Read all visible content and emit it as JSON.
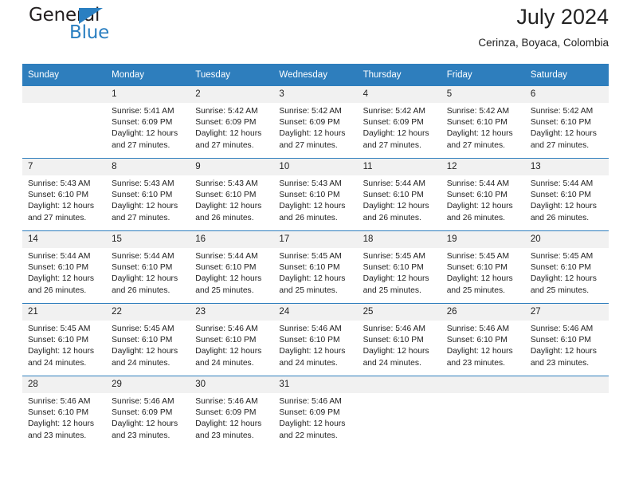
{
  "brand": {
    "name_top": "General",
    "name_bottom": "Blue",
    "accent_color": "#2a7fc1"
  },
  "header": {
    "month_title": "July 2024",
    "location": "Cerinza, Boyaca, Colombia"
  },
  "calendar": {
    "header_bg": "#2e7ebd",
    "daynum_bg": "#f1f1f1",
    "weekday_names": [
      "Sunday",
      "Monday",
      "Tuesday",
      "Wednesday",
      "Thursday",
      "Friday",
      "Saturday"
    ],
    "weeks": [
      [
        {
          "day": "",
          "sunrise": "",
          "sunset": "",
          "daylight_1": "",
          "daylight_2": ""
        },
        {
          "day": "1",
          "sunrise": "Sunrise: 5:41 AM",
          "sunset": "Sunset: 6:09 PM",
          "daylight_1": "Daylight: 12 hours",
          "daylight_2": "and 27 minutes."
        },
        {
          "day": "2",
          "sunrise": "Sunrise: 5:42 AM",
          "sunset": "Sunset: 6:09 PM",
          "daylight_1": "Daylight: 12 hours",
          "daylight_2": "and 27 minutes."
        },
        {
          "day": "3",
          "sunrise": "Sunrise: 5:42 AM",
          "sunset": "Sunset: 6:09 PM",
          "daylight_1": "Daylight: 12 hours",
          "daylight_2": "and 27 minutes."
        },
        {
          "day": "4",
          "sunrise": "Sunrise: 5:42 AM",
          "sunset": "Sunset: 6:09 PM",
          "daylight_1": "Daylight: 12 hours",
          "daylight_2": "and 27 minutes."
        },
        {
          "day": "5",
          "sunrise": "Sunrise: 5:42 AM",
          "sunset": "Sunset: 6:10 PM",
          "daylight_1": "Daylight: 12 hours",
          "daylight_2": "and 27 minutes."
        },
        {
          "day": "6",
          "sunrise": "Sunrise: 5:42 AM",
          "sunset": "Sunset: 6:10 PM",
          "daylight_1": "Daylight: 12 hours",
          "daylight_2": "and 27 minutes."
        }
      ],
      [
        {
          "day": "7",
          "sunrise": "Sunrise: 5:43 AM",
          "sunset": "Sunset: 6:10 PM",
          "daylight_1": "Daylight: 12 hours",
          "daylight_2": "and 27 minutes."
        },
        {
          "day": "8",
          "sunrise": "Sunrise: 5:43 AM",
          "sunset": "Sunset: 6:10 PM",
          "daylight_1": "Daylight: 12 hours",
          "daylight_2": "and 27 minutes."
        },
        {
          "day": "9",
          "sunrise": "Sunrise: 5:43 AM",
          "sunset": "Sunset: 6:10 PM",
          "daylight_1": "Daylight: 12 hours",
          "daylight_2": "and 26 minutes."
        },
        {
          "day": "10",
          "sunrise": "Sunrise: 5:43 AM",
          "sunset": "Sunset: 6:10 PM",
          "daylight_1": "Daylight: 12 hours",
          "daylight_2": "and 26 minutes."
        },
        {
          "day": "11",
          "sunrise": "Sunrise: 5:44 AM",
          "sunset": "Sunset: 6:10 PM",
          "daylight_1": "Daylight: 12 hours",
          "daylight_2": "and 26 minutes."
        },
        {
          "day": "12",
          "sunrise": "Sunrise: 5:44 AM",
          "sunset": "Sunset: 6:10 PM",
          "daylight_1": "Daylight: 12 hours",
          "daylight_2": "and 26 minutes."
        },
        {
          "day": "13",
          "sunrise": "Sunrise: 5:44 AM",
          "sunset": "Sunset: 6:10 PM",
          "daylight_1": "Daylight: 12 hours",
          "daylight_2": "and 26 minutes."
        }
      ],
      [
        {
          "day": "14",
          "sunrise": "Sunrise: 5:44 AM",
          "sunset": "Sunset: 6:10 PM",
          "daylight_1": "Daylight: 12 hours",
          "daylight_2": "and 26 minutes."
        },
        {
          "day": "15",
          "sunrise": "Sunrise: 5:44 AM",
          "sunset": "Sunset: 6:10 PM",
          "daylight_1": "Daylight: 12 hours",
          "daylight_2": "and 26 minutes."
        },
        {
          "day": "16",
          "sunrise": "Sunrise: 5:44 AM",
          "sunset": "Sunset: 6:10 PM",
          "daylight_1": "Daylight: 12 hours",
          "daylight_2": "and 25 minutes."
        },
        {
          "day": "17",
          "sunrise": "Sunrise: 5:45 AM",
          "sunset": "Sunset: 6:10 PM",
          "daylight_1": "Daylight: 12 hours",
          "daylight_2": "and 25 minutes."
        },
        {
          "day": "18",
          "sunrise": "Sunrise: 5:45 AM",
          "sunset": "Sunset: 6:10 PM",
          "daylight_1": "Daylight: 12 hours",
          "daylight_2": "and 25 minutes."
        },
        {
          "day": "19",
          "sunrise": "Sunrise: 5:45 AM",
          "sunset": "Sunset: 6:10 PM",
          "daylight_1": "Daylight: 12 hours",
          "daylight_2": "and 25 minutes."
        },
        {
          "day": "20",
          "sunrise": "Sunrise: 5:45 AM",
          "sunset": "Sunset: 6:10 PM",
          "daylight_1": "Daylight: 12 hours",
          "daylight_2": "and 25 minutes."
        }
      ],
      [
        {
          "day": "21",
          "sunrise": "Sunrise: 5:45 AM",
          "sunset": "Sunset: 6:10 PM",
          "daylight_1": "Daylight: 12 hours",
          "daylight_2": "and 24 minutes."
        },
        {
          "day": "22",
          "sunrise": "Sunrise: 5:45 AM",
          "sunset": "Sunset: 6:10 PM",
          "daylight_1": "Daylight: 12 hours",
          "daylight_2": "and 24 minutes."
        },
        {
          "day": "23",
          "sunrise": "Sunrise: 5:46 AM",
          "sunset": "Sunset: 6:10 PM",
          "daylight_1": "Daylight: 12 hours",
          "daylight_2": "and 24 minutes."
        },
        {
          "day": "24",
          "sunrise": "Sunrise: 5:46 AM",
          "sunset": "Sunset: 6:10 PM",
          "daylight_1": "Daylight: 12 hours",
          "daylight_2": "and 24 minutes."
        },
        {
          "day": "25",
          "sunrise": "Sunrise: 5:46 AM",
          "sunset": "Sunset: 6:10 PM",
          "daylight_1": "Daylight: 12 hours",
          "daylight_2": "and 24 minutes."
        },
        {
          "day": "26",
          "sunrise": "Sunrise: 5:46 AM",
          "sunset": "Sunset: 6:10 PM",
          "daylight_1": "Daylight: 12 hours",
          "daylight_2": "and 23 minutes."
        },
        {
          "day": "27",
          "sunrise": "Sunrise: 5:46 AM",
          "sunset": "Sunset: 6:10 PM",
          "daylight_1": "Daylight: 12 hours",
          "daylight_2": "and 23 minutes."
        }
      ],
      [
        {
          "day": "28",
          "sunrise": "Sunrise: 5:46 AM",
          "sunset": "Sunset: 6:10 PM",
          "daylight_1": "Daylight: 12 hours",
          "daylight_2": "and 23 minutes."
        },
        {
          "day": "29",
          "sunrise": "Sunrise: 5:46 AM",
          "sunset": "Sunset: 6:09 PM",
          "daylight_1": "Daylight: 12 hours",
          "daylight_2": "and 23 minutes."
        },
        {
          "day": "30",
          "sunrise": "Sunrise: 5:46 AM",
          "sunset": "Sunset: 6:09 PM",
          "daylight_1": "Daylight: 12 hours",
          "daylight_2": "and 23 minutes."
        },
        {
          "day": "31",
          "sunrise": "Sunrise: 5:46 AM",
          "sunset": "Sunset: 6:09 PM",
          "daylight_1": "Daylight: 12 hours",
          "daylight_2": "and 22 minutes."
        },
        {
          "day": "",
          "sunrise": "",
          "sunset": "",
          "daylight_1": "",
          "daylight_2": ""
        },
        {
          "day": "",
          "sunrise": "",
          "sunset": "",
          "daylight_1": "",
          "daylight_2": ""
        },
        {
          "day": "",
          "sunrise": "",
          "sunset": "",
          "daylight_1": "",
          "daylight_2": ""
        }
      ]
    ]
  }
}
